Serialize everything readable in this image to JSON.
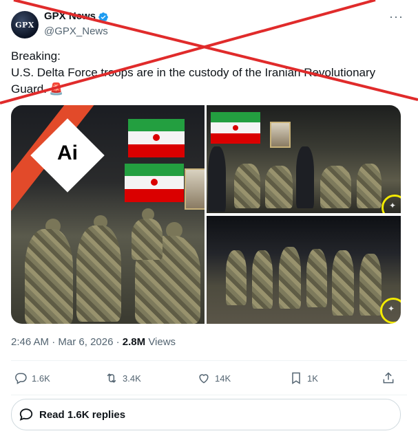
{
  "author": {
    "name": "GPX News",
    "handle": "@GPX_News",
    "avatar_text": "GPX",
    "verified": true
  },
  "tweet": {
    "text": "Breaking:\nU.S. Delta Force troops are in the custody of the Iranian Revolutionary Guard.",
    "emoji": "🚨"
  },
  "media": {
    "badge_text": "Ai",
    "highlight_color": "#f3ea00",
    "stripe_color": "#e24a2a"
  },
  "meta": {
    "time": "2:46 AM",
    "separator": "·",
    "date": "Mar 6, 2026",
    "views_count": "2.8M",
    "views_label": "Views"
  },
  "actions": {
    "reply_count": "1.6K",
    "retweet_count": "3.4K",
    "like_count": "14K",
    "bookmark_count": "1K"
  },
  "replies_button": {
    "label": "Read 1.6K replies"
  },
  "colors": {
    "cross_out": "#e02b2b",
    "secondary_text": "#536471"
  }
}
